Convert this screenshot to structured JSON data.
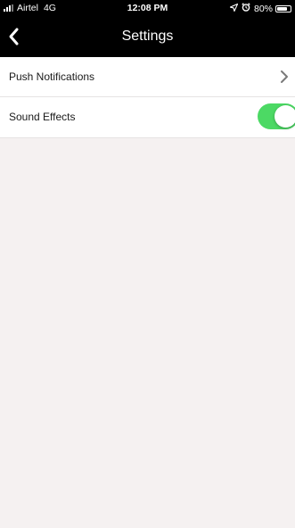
{
  "status_bar": {
    "carrier": "Airtel",
    "network": "4G",
    "time": "12:08 PM",
    "battery_percent": "80%",
    "battery_level": 0.8,
    "icons": [
      "signal-icon",
      "location-icon",
      "alarm-icon",
      "battery-icon"
    ]
  },
  "nav": {
    "title": "Settings",
    "back_icon": "chevron-left-icon"
  },
  "settings": {
    "items": [
      {
        "label": "Push Notifications",
        "control": "chevron-right-icon"
      },
      {
        "label": "Sound Effects",
        "control": "toggle",
        "enabled": true
      }
    ]
  },
  "colors": {
    "toolbar_background": "#000000",
    "toggle_on": "#4cd964",
    "content_background": "#f5f1f1"
  }
}
